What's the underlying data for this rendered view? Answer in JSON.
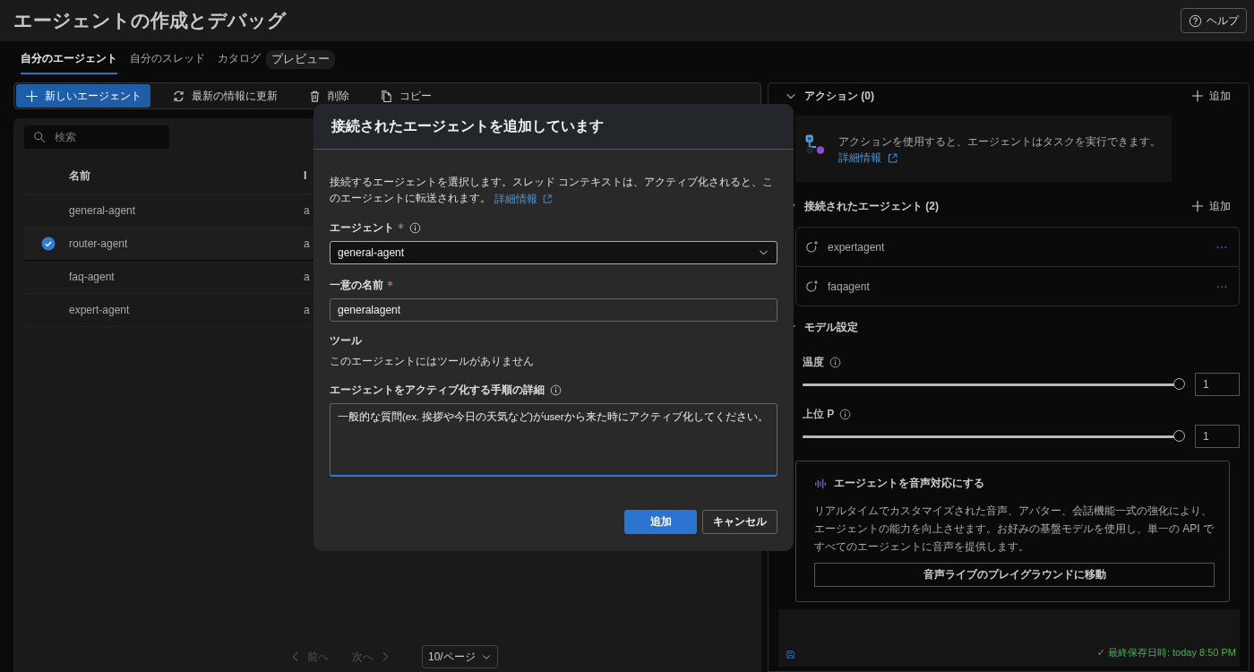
{
  "page": {
    "title": "エージェントの作成とデバッグ",
    "help": "ヘルプ"
  },
  "tabs": [
    {
      "label": "自分のエージェント",
      "selected": true
    },
    {
      "label": "自分のスレッド",
      "selected": false
    },
    {
      "label": "カタログ",
      "selected": false,
      "badge": "プレビュー"
    }
  ],
  "toolbar": [
    {
      "label": "新しいエージェント",
      "kind": "new"
    },
    {
      "label": "最新の情報に更新",
      "kind": "refresh"
    },
    {
      "label": "削除",
      "kind": "delete"
    },
    {
      "label": "コピー",
      "kind": "copy"
    }
  ],
  "agent_table": {
    "search": {
      "placeholder": "検索"
    },
    "columns": [
      "名前",
      "I"
    ],
    "rows": [
      {
        "name": "general-agent",
        "column_2": "a",
        "selected": false
      },
      {
        "name": "router-agent",
        "column_2": "a",
        "selected": true
      },
      {
        "name": "faq-agent",
        "column_2": "a",
        "selected": false
      },
      {
        "name": "expert-agent",
        "column_2": "a",
        "selected": false
      }
    ]
  },
  "pagination": {
    "buttons": [
      {
        "label": "前へ",
        "kind": "previous",
        "disabled": true
      },
      {
        "label": "次へ",
        "kind": "next",
        "disabled": true
      }
    ],
    "page_size": "10/ページ"
  },
  "side_panel": {
    "actions": {
      "title": "アクション (0)",
      "add": "追加",
      "expanded": true,
      "info": "アクションを使用すると、エージェントはタスクを実行できます。",
      "link": "詳細情報"
    },
    "connected_agents": {
      "title": "接続されたエージェント (2)",
      "add": "追加",
      "expanded": true,
      "items": [
        {
          "name": "expertagent"
        },
        {
          "name": "faqagent"
        }
      ]
    },
    "model_settings": {
      "title": "モデル設定",
      "expanded": true,
      "params": [
        {
          "label": "温度",
          "level": 1,
          "value": "1"
        },
        {
          "label": "上位 P",
          "level": 1,
          "value": "1"
        }
      ]
    },
    "voice": {
      "title": "エージェントを音声対応にする",
      "text": "リアルタイムでカスタマイズされた音声、アバター、会話機能一式の強化により、エージェントの能力を向上させます。お好みの基盤モデルを使用し、単一の API ですべてのエージェントに音声を提供します。",
      "button": "音声ライブのプレイグラウンドに移動"
    },
    "save_status": "✓ 最終保存日時: today 8:50 PM"
  },
  "dialog": {
    "title": "接続されたエージェントを追加しています",
    "description": "接続するエージェントを選択します。スレッド コンテキストは、アクティブ化されると、このエージェントに転送されます。",
    "link": "詳細情報",
    "fields": [
      {
        "kind": "select",
        "label": "エージェント",
        "required": true,
        "info": true,
        "value": "general-agent"
      },
      {
        "kind": "text",
        "label": "一意の名前",
        "required": true,
        "value": "generalagent"
      },
      {
        "kind": "static",
        "label": "ツール",
        "value": "このエージェントにはツールがありません"
      },
      {
        "kind": "textarea",
        "label": "エージェントをアクティブ化する手順の詳細",
        "info": true,
        "value": "一般的な質問(ex. 挨拶や今日の天気など)がuserから来た時にアクティブ化してください。",
        "focused": true
      }
    ],
    "buttons": [
      {
        "label": "追加",
        "kind": "primary"
      },
      {
        "label": "キャンセル",
        "kind": "secondary"
      }
    ]
  }
}
